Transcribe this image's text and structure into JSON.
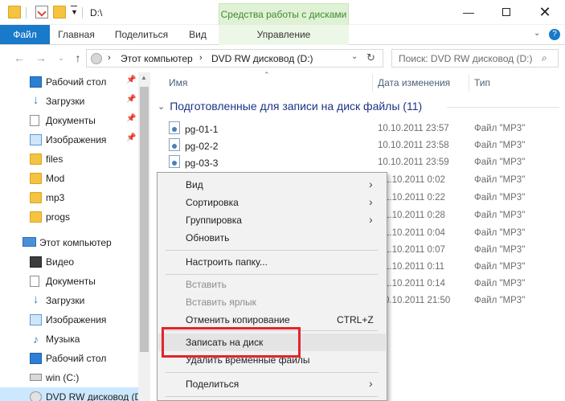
{
  "window": {
    "path": "D:\\",
    "context_tools_label": "Средства работы с дисками"
  },
  "ribbon": {
    "tabs": [
      "Файл",
      "Главная",
      "Поделиться",
      "Вид"
    ],
    "context_tab": "Управление"
  },
  "navigation": {
    "breadcrumb": [
      "Этот компьютер",
      "DVD RW дисковод (D:)"
    ],
    "search_placeholder": "Поиск: DVD RW дисковод (D:)"
  },
  "sidebar": {
    "quick_access": [
      {
        "label": "Рабочий стол",
        "icon": "desktop-icon",
        "pinned": true
      },
      {
        "label": "Загрузки",
        "icon": "download-icon",
        "pinned": true
      },
      {
        "label": "Документы",
        "icon": "documents-icon",
        "pinned": true
      },
      {
        "label": "Изображения",
        "icon": "pictures-icon",
        "pinned": true
      },
      {
        "label": "files",
        "icon": "folder-icon",
        "pinned": false
      },
      {
        "label": "Mod",
        "icon": "folder-icon",
        "pinned": false
      },
      {
        "label": "mp3",
        "icon": "folder-icon",
        "pinned": false
      },
      {
        "label": "progs",
        "icon": "folder-icon",
        "pinned": false
      }
    ],
    "this_pc_label": "Этот компьютер",
    "this_pc_items": [
      {
        "label": "Видео",
        "icon": "video-icon"
      },
      {
        "label": "Документы",
        "icon": "documents-icon"
      },
      {
        "label": "Загрузки",
        "icon": "download-icon"
      },
      {
        "label": "Изображения",
        "icon": "pictures-icon"
      },
      {
        "label": "Музыка",
        "icon": "music-icon"
      },
      {
        "label": "Рабочий стол",
        "icon": "desktop-icon"
      },
      {
        "label": "win (C:)",
        "icon": "drive-icon"
      },
      {
        "label": "DVD RW дисковод (D:",
        "icon": "dvd-icon"
      }
    ]
  },
  "file_list": {
    "columns": [
      "Имя",
      "Дата изменения",
      "Тип"
    ],
    "group_header": "Подготовленные для записи на диск файлы (11)",
    "files": [
      {
        "name": "pg-01-1",
        "date": "10.10.2011 23:57",
        "type": "Файл \"MP3\""
      },
      {
        "name": "pg-02-2",
        "date": "10.10.2011 23:58",
        "type": "Файл \"MP3\""
      },
      {
        "name": "pg-03-3",
        "date": "10.10.2011 23:59",
        "type": "Файл \"MP3\""
      },
      {
        "name": "",
        "date": "1.10.2011 0:02",
        "type": "Файл \"MP3\""
      },
      {
        "name": "",
        "date": "1.10.2011 0:22",
        "type": "Файл \"MP3\""
      },
      {
        "name": "",
        "date": "1.10.2011 0:28",
        "type": "Файл \"MP3\""
      },
      {
        "name": "",
        "date": "1.10.2011 0:04",
        "type": "Файл \"MP3\""
      },
      {
        "name": "",
        "date": "1.10.2011 0:07",
        "type": "Файл \"MP3\""
      },
      {
        "name": "",
        "date": "1.10.2011 0:11",
        "type": "Файл \"MP3\""
      },
      {
        "name": "",
        "date": "1.10.2011 0:14",
        "type": "Файл \"MP3\""
      },
      {
        "name": "",
        "date": "0.10.2011 21:50",
        "type": "Файл \"MP3\""
      }
    ]
  },
  "context_menu": {
    "view": "Вид",
    "sort": "Сортировка",
    "group": "Группировка",
    "refresh": "Обновить",
    "customize": "Настроить папку...",
    "paste": "Вставить",
    "paste_shortcut": "Вставить ярлык",
    "undo_copy": "Отменить копирование",
    "undo_shortcut": "CTRL+Z",
    "burn": "Записать на диск",
    "delete_temp": "Удалить временные файлы",
    "share": "Поделиться"
  },
  "colors": {
    "file_tab": "#1979ca",
    "context_tools": "#e0f2d6",
    "highlight_box": "#e0262b",
    "group_header": "#1e3287"
  }
}
